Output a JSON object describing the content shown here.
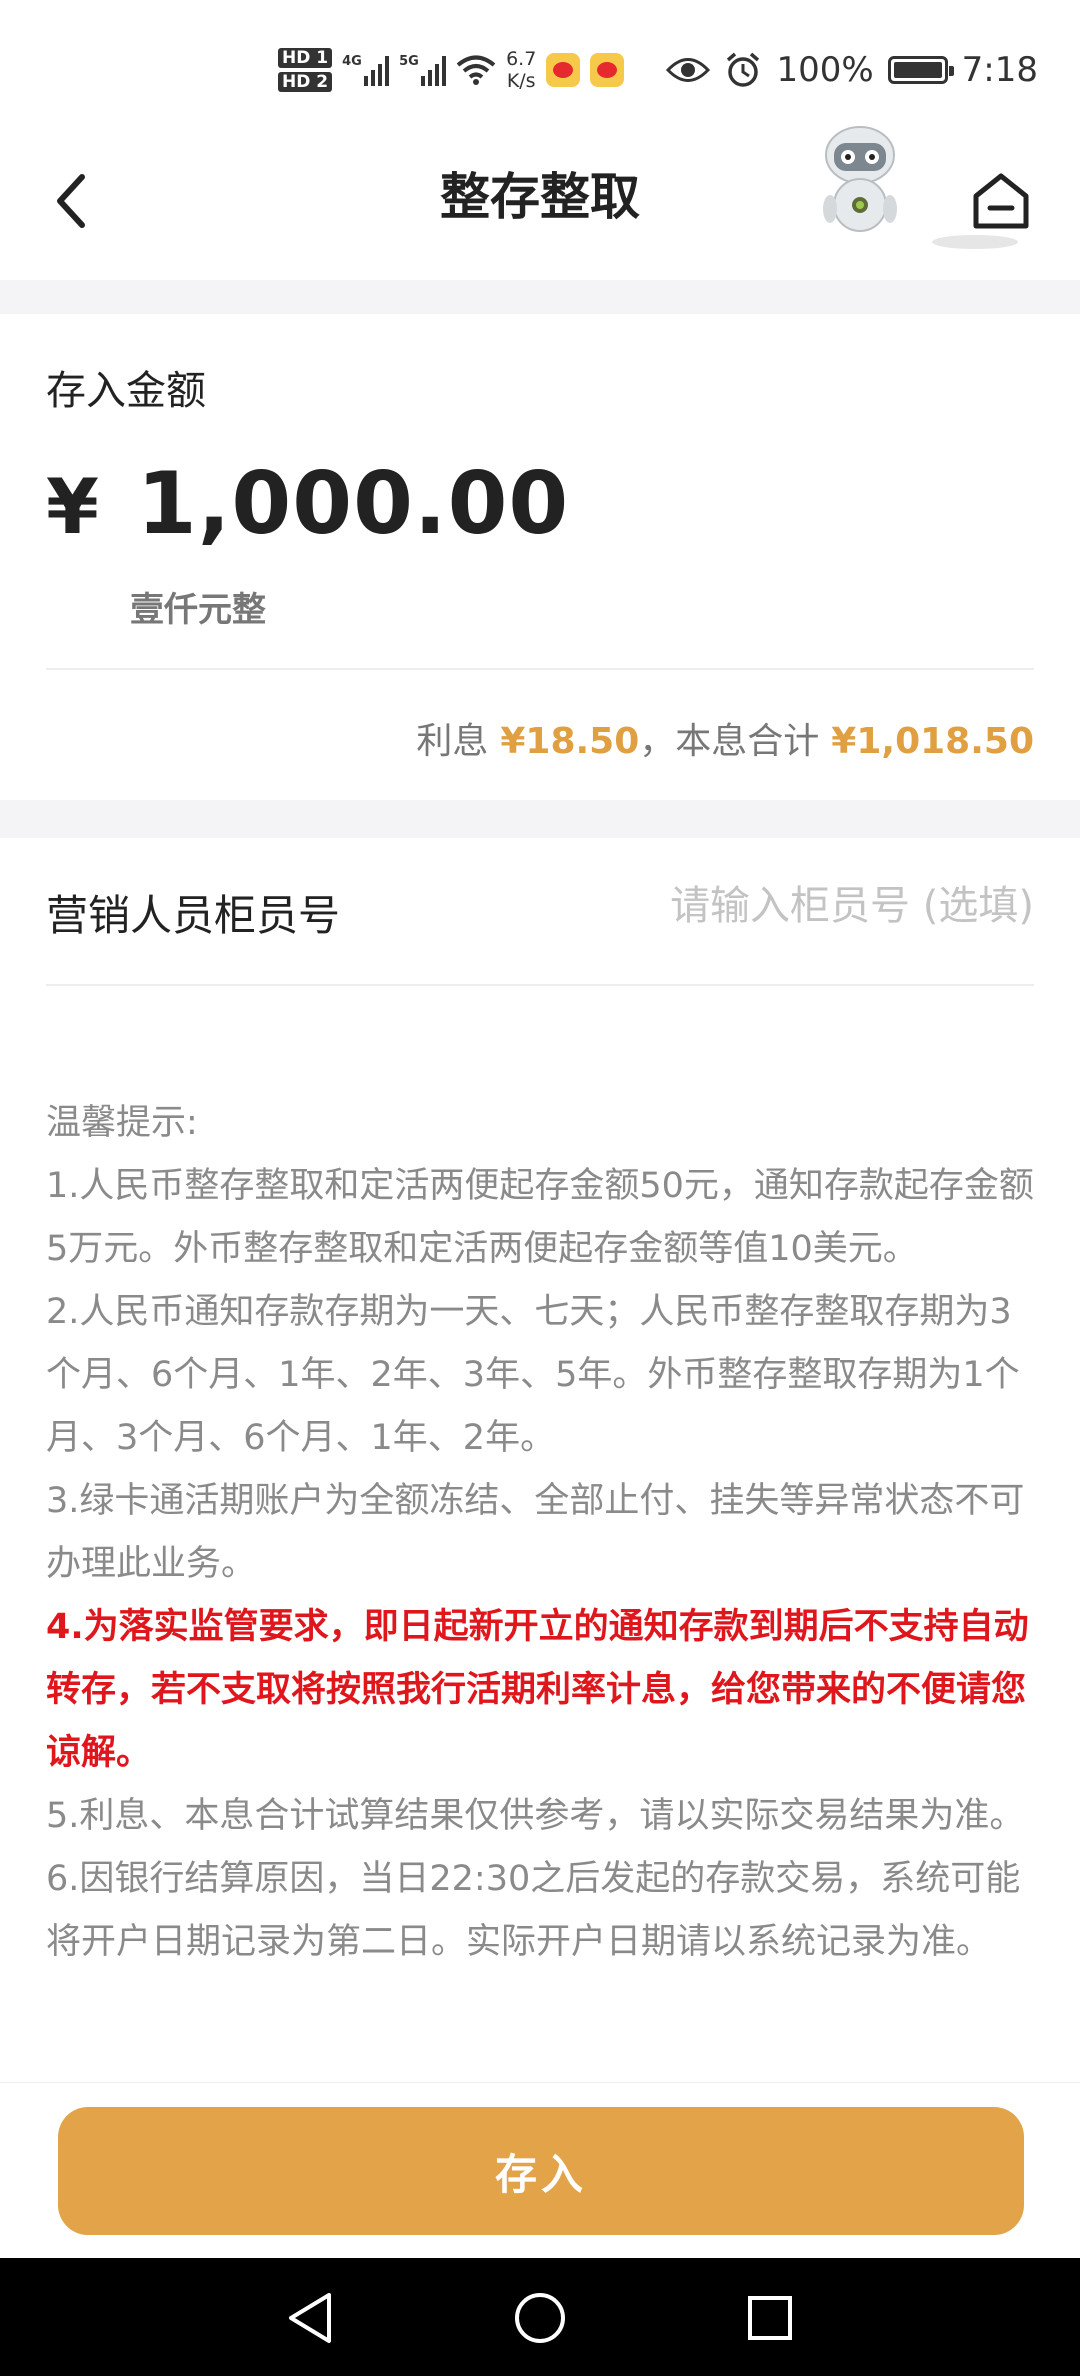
{
  "status_bar": {
    "hd1": "HD 1",
    "hd2": "HD 2",
    "net1": "4G",
    "net2": "5G",
    "speed_value": "6.7",
    "speed_unit": "K/s",
    "battery": "100%",
    "time": "7:18",
    "icons": [
      "eye-icon",
      "alarm-icon",
      "battery-icon",
      "wifi-icon",
      "weibo-icon"
    ]
  },
  "nav": {
    "title": "整存整取",
    "back_icon": "chevron-left-icon",
    "home_icon": "home-icon",
    "mascot": "robot-mascot"
  },
  "amount": {
    "label": "存入金额",
    "currency": "¥",
    "value": "1,000.00",
    "chinese": "壹仟元整"
  },
  "interest": {
    "interest_label": "利息",
    "interest_value": "¥18.50",
    "separator": "，",
    "total_label": "本息合计",
    "total_value": "¥1,018.50"
  },
  "teller": {
    "label": "营销人员柜员号",
    "placeholder": "请输入柜员号 (选填)",
    "value": ""
  },
  "tips": {
    "heading": "温馨提示:",
    "items": [
      "1.人民币整存整取和定活两便起存金额50元，通知存款起存金额5万元。外币整存整取和定活两便起存金额等值10美元。",
      "2.人民币通知存款存期为一天、七天；人民币整存整取存期为3个月、6个月、1年、2年、3年、5年。外币整存整取存期为1个月、3个月、6个月、1年、2年。",
      "3.绿卡通活期账户为全额冻结、全部止付、挂失等异常状态不可办理此业务。",
      "4.为落实监管要求，即日起新开立的通知存款到期后不支持自动转存，若不支取将按照我行活期利率计息，给您带来的不便请您谅解。",
      "5.利息、本息合计试算结果仅供参考，请以实际交易结果为准。",
      "6.因银行结算原因，当日22:30之后发起的存款交易，系统可能将开户日期记录为第二日。实际开户日期请以系统记录为准。"
    ]
  },
  "button": {
    "deposit": "存入"
  },
  "colors": {
    "accent": "#e3a348",
    "gold_text": "#e0a041",
    "warning_red": "#e0161d",
    "muted": "#8a8a8a"
  }
}
